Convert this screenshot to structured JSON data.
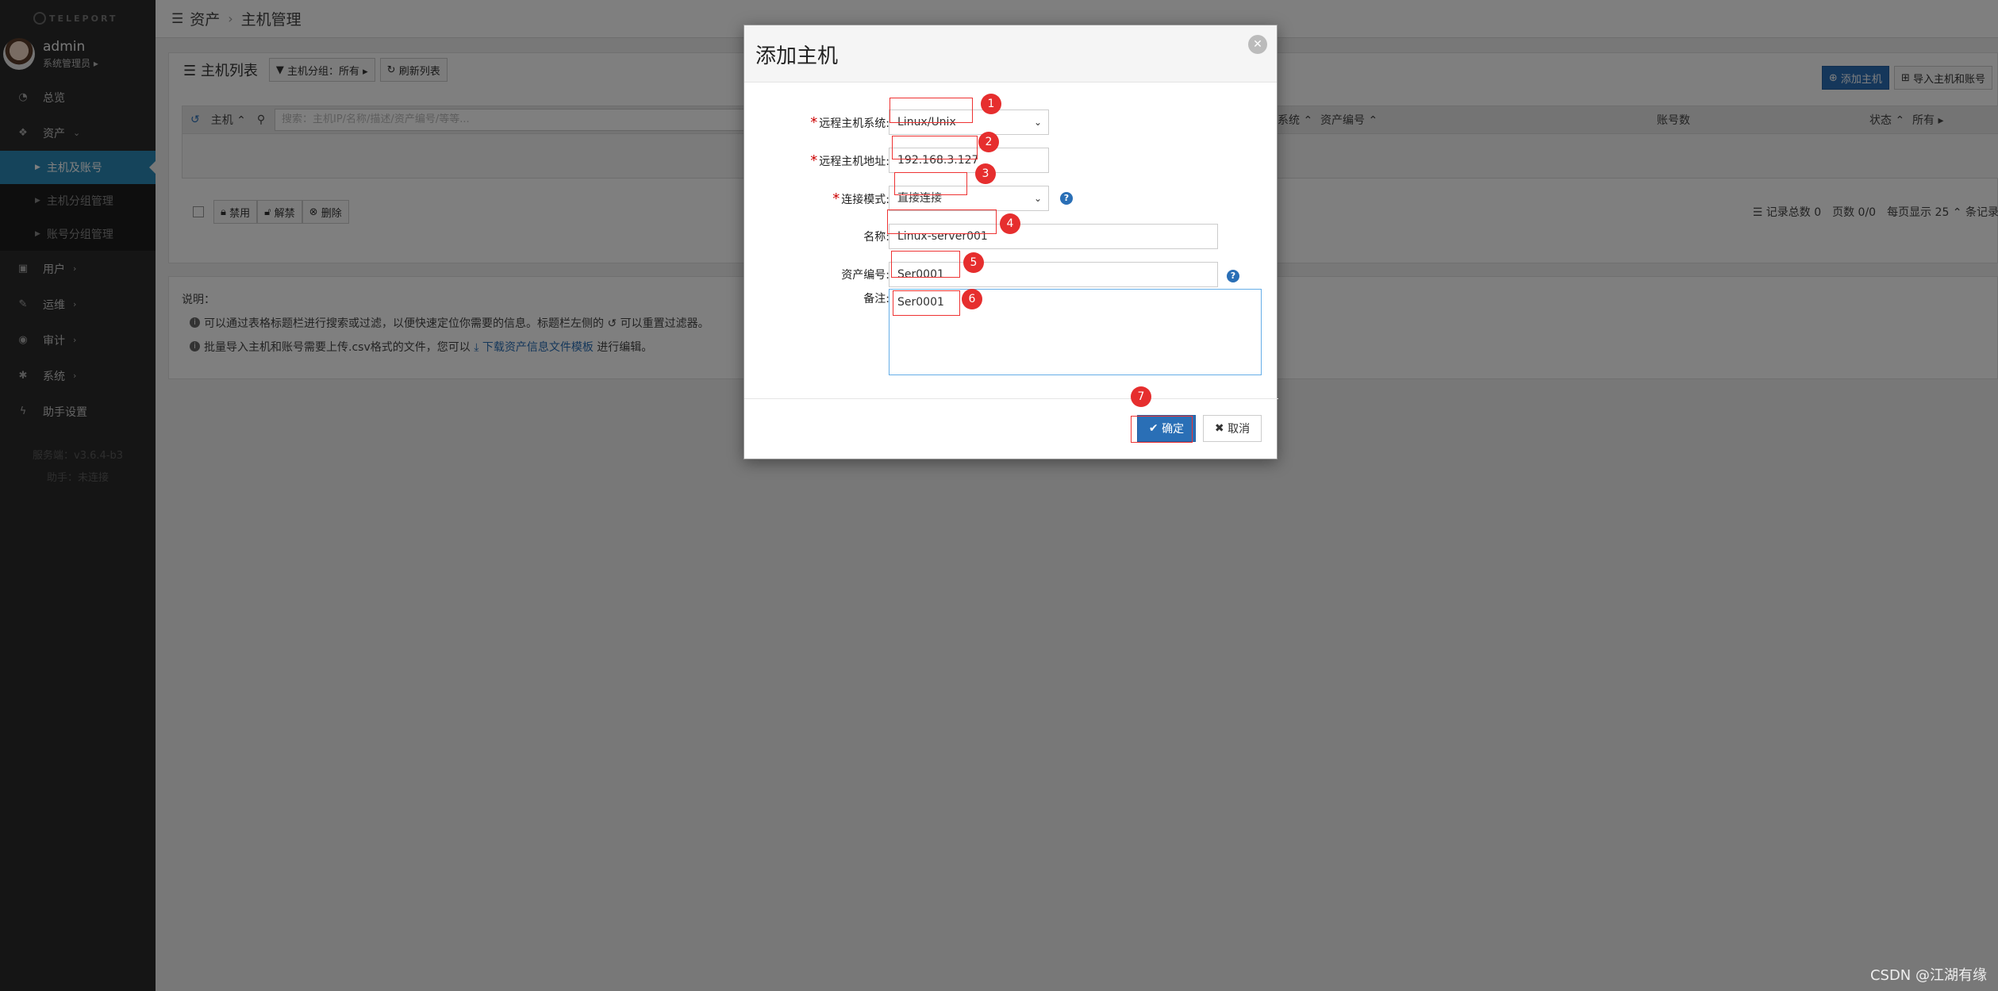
{
  "brand": "TELEPORT",
  "user": {
    "name": "admin",
    "role": "系统管理员 ▸"
  },
  "nav": {
    "overview": "总览",
    "assets": "资产",
    "sub": [
      "主机及账号",
      "主机分组管理",
      "账号分组管理"
    ],
    "users": "用户",
    "ops": "运维",
    "audit": "审计",
    "system": "系统",
    "assistant": "助手设置"
  },
  "version": {
    "server": "服务端：v3.6.4-b3",
    "assistant": "助手：未连接"
  },
  "breadcrumb": {
    "root": "资产",
    "current": "主机管理"
  },
  "list": {
    "title": "主机列表",
    "group_filter": "主机分组：所有 ▸",
    "refresh": "刷新列表",
    "add_host": "添加主机",
    "import": "导入主机和账号",
    "col_host": "主机 ⌃",
    "search_placeholder": "搜索：主机IP/名称/描述/资产编号/等等...",
    "col_system": "系统 ⌃",
    "col_asset_no": "资产编号 ⌃",
    "col_accounts": "账号数",
    "col_status": "状态 ⌃",
    "col_status_filter": "所有 ▸",
    "btn_disable": "禁用",
    "btn_unlock": "解禁",
    "btn_delete": "删除",
    "pager": "☰ 记录总数 0　页数 0/0　每页显示 25 ⌃ 条记录"
  },
  "note": {
    "title": "说明：",
    "line1": "可以通过表格标题栏进行搜索或过滤，以便快速定位你需要的信息。标题栏左侧的 ↺ 可以重置过滤器。",
    "line2_pre": "批量导入主机和账号需要上传.csv格式的文件，您可以",
    "line2_link": "下载资产信息文件模板",
    "line2_post": "进行编辑。"
  },
  "modal": {
    "title": "添加主机",
    "os_label": "远程主机系统:",
    "os_value": "Linux/Unix",
    "ip_label": "远程主机地址:",
    "ip_value": "192.168.3.127",
    "mode_label": "连接模式:",
    "mode_value": "直接连接",
    "name_label": "名称:",
    "name_value": "Linux-server001",
    "asset_label": "资产编号:",
    "asset_value": "Ser0001",
    "remark_label": "备注:",
    "remark_value": "Ser0001",
    "ok": "确定",
    "cancel": "取消"
  },
  "badges": [
    "1",
    "2",
    "3",
    "4",
    "5",
    "6",
    "7"
  ],
  "watermark": "CSDN @江湖有缘",
  "colors": {
    "accent": "#2a6fb6",
    "marker": "#e62e2e",
    "sidebar_active": "#2a88b6"
  }
}
